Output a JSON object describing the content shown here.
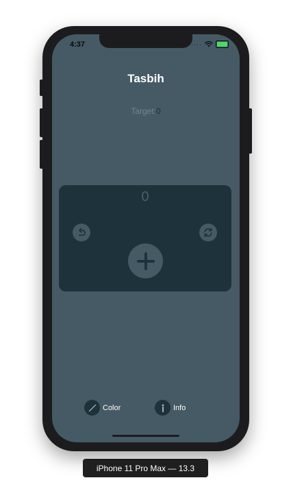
{
  "status_bar": {
    "time": "4:37",
    "signal_dots": "····",
    "wifi_icon": "wifi-icon",
    "battery_icon": "battery-charging-icon",
    "battery_level": 1.0,
    "battery_color": "#4cd964"
  },
  "header": {
    "title": "Tasbih"
  },
  "target": {
    "label": "Target:",
    "value": "0"
  },
  "counter": {
    "count": "0",
    "undo_icon": "undo-icon",
    "reset_icon": "refresh-icon",
    "increment_icon": "plus-icon"
  },
  "toolbar": {
    "color_label": "Color",
    "color_icon": "pencil-icon",
    "info_label": "Info",
    "info_icon": "info-icon"
  },
  "simulator": {
    "device_label": "iPhone 11 Pro Max — 13.3"
  },
  "colors": {
    "screen_background": "#455a64",
    "card_background": "#1d323a",
    "device_frame": "#1c1c1e"
  }
}
